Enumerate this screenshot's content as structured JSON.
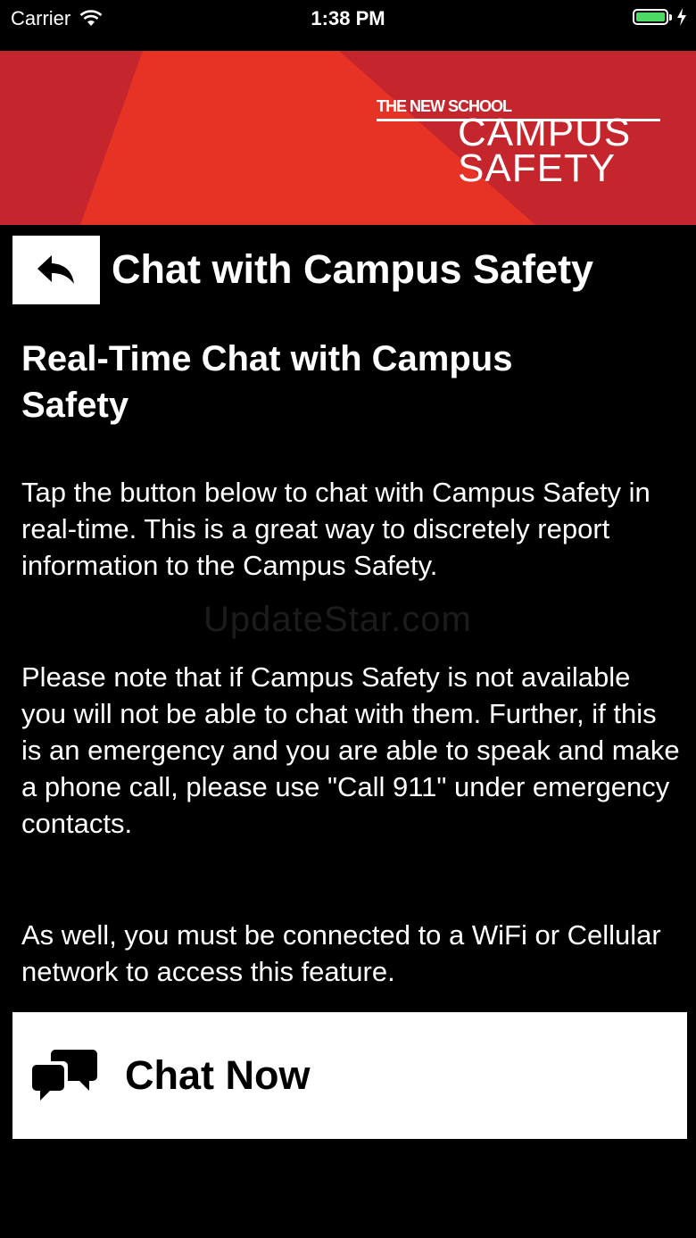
{
  "status_bar": {
    "carrier": "Carrier",
    "time": "1:38 PM",
    "battery_color": "#4cd964"
  },
  "banner": {
    "school": "THE NEW SCHOOL",
    "campus": "CAMPUS",
    "safety": "SAFETY",
    "colors": [
      "#c5252d",
      "#e63326",
      "#a3202a"
    ]
  },
  "header": {
    "back_icon": "reply-arrow-icon",
    "title": "Chat with Campus Safety"
  },
  "content": {
    "heading": "Real-Time Chat with Campus Safety",
    "paragraph_1": "Tap the button below to chat with Campus Safety in real-time. This is a great way to discretely report information to the Campus Safety.",
    "paragraph_2": "Please note that if Campus Safety is not available you will not be able to chat with them. Further, if this is an emergency and you are able to speak and make a phone call, please use \"Call 911\" under emergency contacts.",
    "paragraph_3": "As well, you must be connected to a WiFi or Cellular network to access this feature."
  },
  "watermark": "UpdateStar.com",
  "chat_button": {
    "icon": "chat-bubbles-icon",
    "label": "Chat Now"
  }
}
